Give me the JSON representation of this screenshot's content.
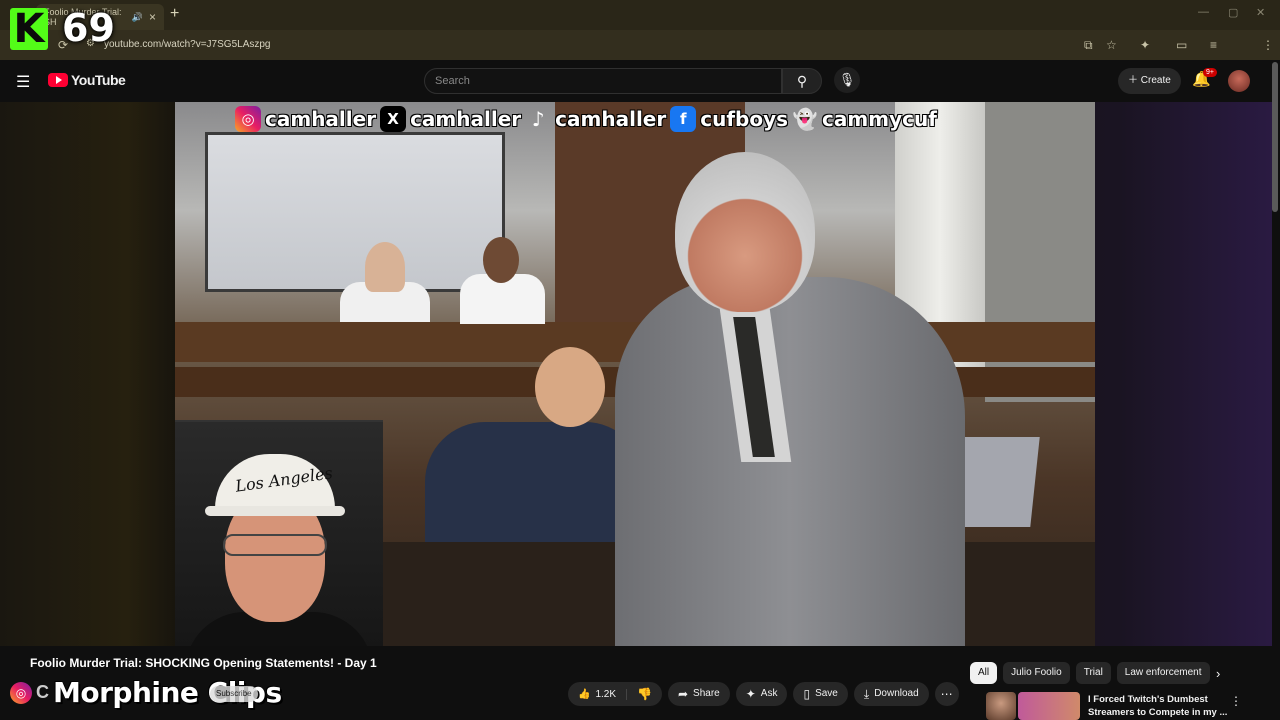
{
  "browser": {
    "tab_title": "Foolio Murder Trial: SH",
    "tab_audio_icon": "speaker-icon",
    "url": "youtube.com/watch?v=J7SG5LAszpg",
    "new_tab": "+",
    "tab_close": "×"
  },
  "overlay": {
    "kick_logo": "K",
    "viewer_count": "69"
  },
  "youtube_header": {
    "logo_text": "YouTube",
    "search_placeholder": "Search",
    "create_label": "Create",
    "notification_badge": "9+"
  },
  "video": {
    "socials": [
      {
        "icon": "instagram-icon",
        "handle": "camhaller"
      },
      {
        "icon": "x-icon",
        "handle": "camhaller"
      },
      {
        "icon": "tiktok-icon",
        "handle": "camhaller"
      },
      {
        "icon": "facebook-icon",
        "handle": "cufboys"
      },
      {
        "icon": "snapchat-icon",
        "handle": "cammycuf"
      }
    ],
    "hat_text": "Los Angeles"
  },
  "below": {
    "title": "Foolio Murder Trial: SHOCKING Opening Statements! - Day 1",
    "channel_watermark": "Morphine Clips",
    "channel_c": "C",
    "subscribe_label": "Subscribe",
    "like_count": "1.2K",
    "share_label": "Share",
    "ask_label": "Ask",
    "save_label": "Save",
    "download_label": "Download"
  },
  "chips": [
    "All",
    "Julio Foolio",
    "Trial",
    "Law enforcement"
  ],
  "recommended": {
    "title_line1": "I Forced Twitch's Dumbest",
    "title_line2": "Streamers to Compete in my ..."
  },
  "colors": {
    "kick_green": "#53fc18",
    "youtube_red": "#ff0033",
    "background": "#0f0f0f"
  }
}
